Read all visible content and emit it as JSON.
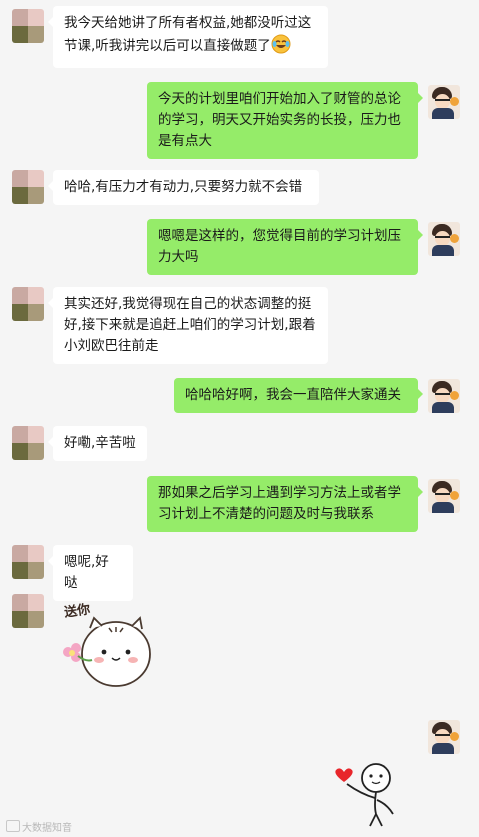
{
  "chat": {
    "messages": [
      {
        "side": "left",
        "text": "我今天给她讲了所有者权益,她都没听过这节课,听我讲完以后可以直接做题了"
      },
      {
        "side": "right",
        "text": "今天的计划里咱们开始加入了财管的总论的学习，明天又开始实务的长投，压力也是有点大"
      },
      {
        "side": "left",
        "text": "哈哈,有压力才有动力,只要努力就不会错"
      },
      {
        "side": "right",
        "text": "嗯嗯是这样的，您觉得目前的学习计划压力大吗"
      },
      {
        "side": "left",
        "text": "其实还好,我觉得现在自己的状态调整的挺好,接下来就是追赶上咱们的学习计划,跟着小刘欧巴往前走"
      },
      {
        "side": "right",
        "text": "哈哈哈好啊，我会一直陪伴大家通关"
      },
      {
        "side": "left",
        "text": "好嘞,辛苦啦"
      },
      {
        "side": "right",
        "text": "那如果之后学习上遇到学习方法上或者学习计划上不清楚的问题及时与我联系"
      },
      {
        "side": "left",
        "text": "嗯呢,好哒"
      }
    ],
    "sticker_left_caption": "送你",
    "watermark": "大数据知音"
  },
  "colors": {
    "background": "#f5f5f5",
    "bubble_self": "#95ec69",
    "bubble_other": "#ffffff"
  }
}
